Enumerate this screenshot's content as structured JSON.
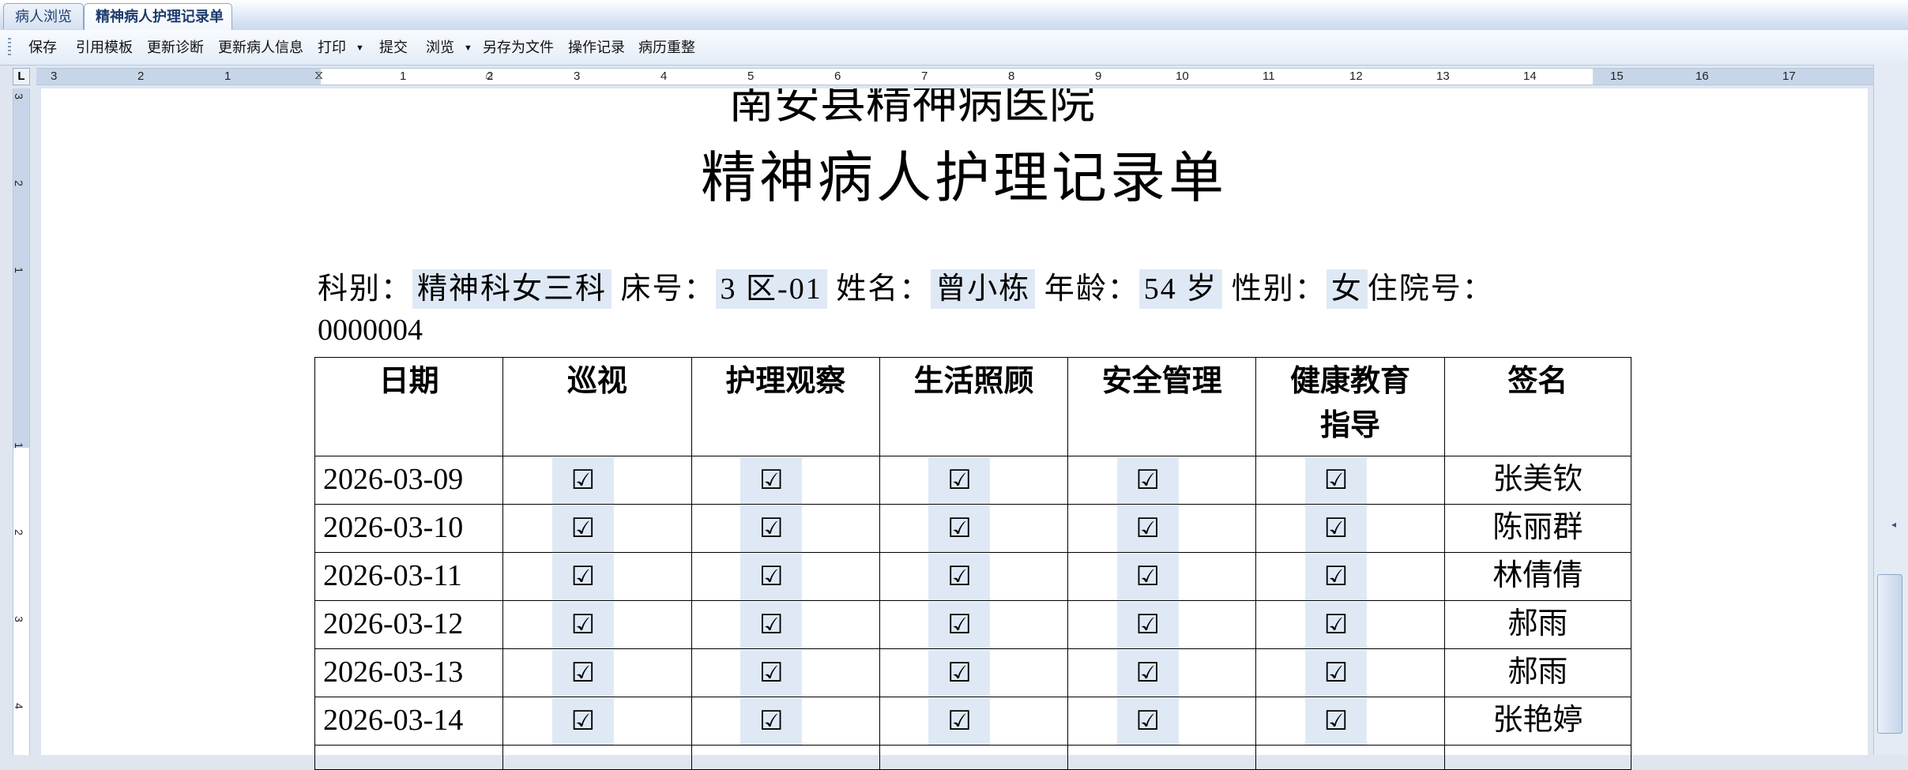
{
  "tabs": [
    {
      "label": "病人浏览",
      "active": false
    },
    {
      "label": "精神病人护理记录单",
      "active": true
    }
  ],
  "toolbar": {
    "items": [
      "保存",
      "引用模板",
      "更新诊断",
      "更新病人信息",
      "打印",
      "提交",
      "浏览",
      "另存为文件",
      "操作记录",
      "病历重整"
    ]
  },
  "ruler": {
    "corner": "L",
    "horizontal_labels": [
      "3",
      "2",
      "1",
      "1",
      "2",
      "3",
      "4",
      "5",
      "6",
      "7",
      "8",
      "9",
      "10",
      "11",
      "12",
      "13",
      "14",
      "15",
      "16",
      "17"
    ],
    "vertical_labels": [
      "3",
      "2",
      "1",
      "1",
      "2",
      "3",
      "4"
    ]
  },
  "document": {
    "hospital_name": "南安县精神病医院",
    "title": "精神病人护理记录单",
    "info": {
      "dept_label": "科别：",
      "dept_value": "精神科女三科",
      "bed_label": "床号：",
      "bed_value": "3 区-01",
      "name_label": "姓名：",
      "name_value": "曾小栋",
      "age_label": "年龄：",
      "age_value": "54 岁",
      "sex_label": "性别：",
      "sex_value": "女",
      "admission_label": "住院号：",
      "admission_value": "0000004"
    },
    "table": {
      "headers": [
        "日期",
        "巡视",
        "护理观察",
        "生活照顾",
        "安全管理",
        "健康教育\n指导",
        "签名"
      ],
      "rows": [
        {
          "date": "2026-03-09",
          "checks": [
            "☑",
            "☑",
            "☑",
            "☑",
            "☑"
          ],
          "signature": "张美钦"
        },
        {
          "date": "2026-03-10",
          "checks": [
            "☑",
            "☑",
            "☑",
            "☑",
            "☑"
          ],
          "signature": "陈丽群"
        },
        {
          "date": "2026-03-11",
          "checks": [
            "☑",
            "☑",
            "☑",
            "☑",
            "☑"
          ],
          "signature": "林倩倩"
        },
        {
          "date": "2026-03-12",
          "checks": [
            "☑",
            "☑",
            "☑",
            "☑",
            "☑"
          ],
          "signature": "郝雨"
        },
        {
          "date": "2026-03-13",
          "checks": [
            "☑",
            "☑",
            "☑",
            "☑",
            "☑"
          ],
          "signature": "郝雨"
        },
        {
          "date": "2026-03-14",
          "checks": [
            "☑",
            "☑",
            "☑",
            "☑",
            "☑"
          ],
          "signature": "张艳婷"
        }
      ]
    }
  },
  "colors": {
    "field_highlight": "#dfe9f6",
    "toolbar_bg": "#e3ecf7",
    "tab_text": "#1d3c6e"
  }
}
